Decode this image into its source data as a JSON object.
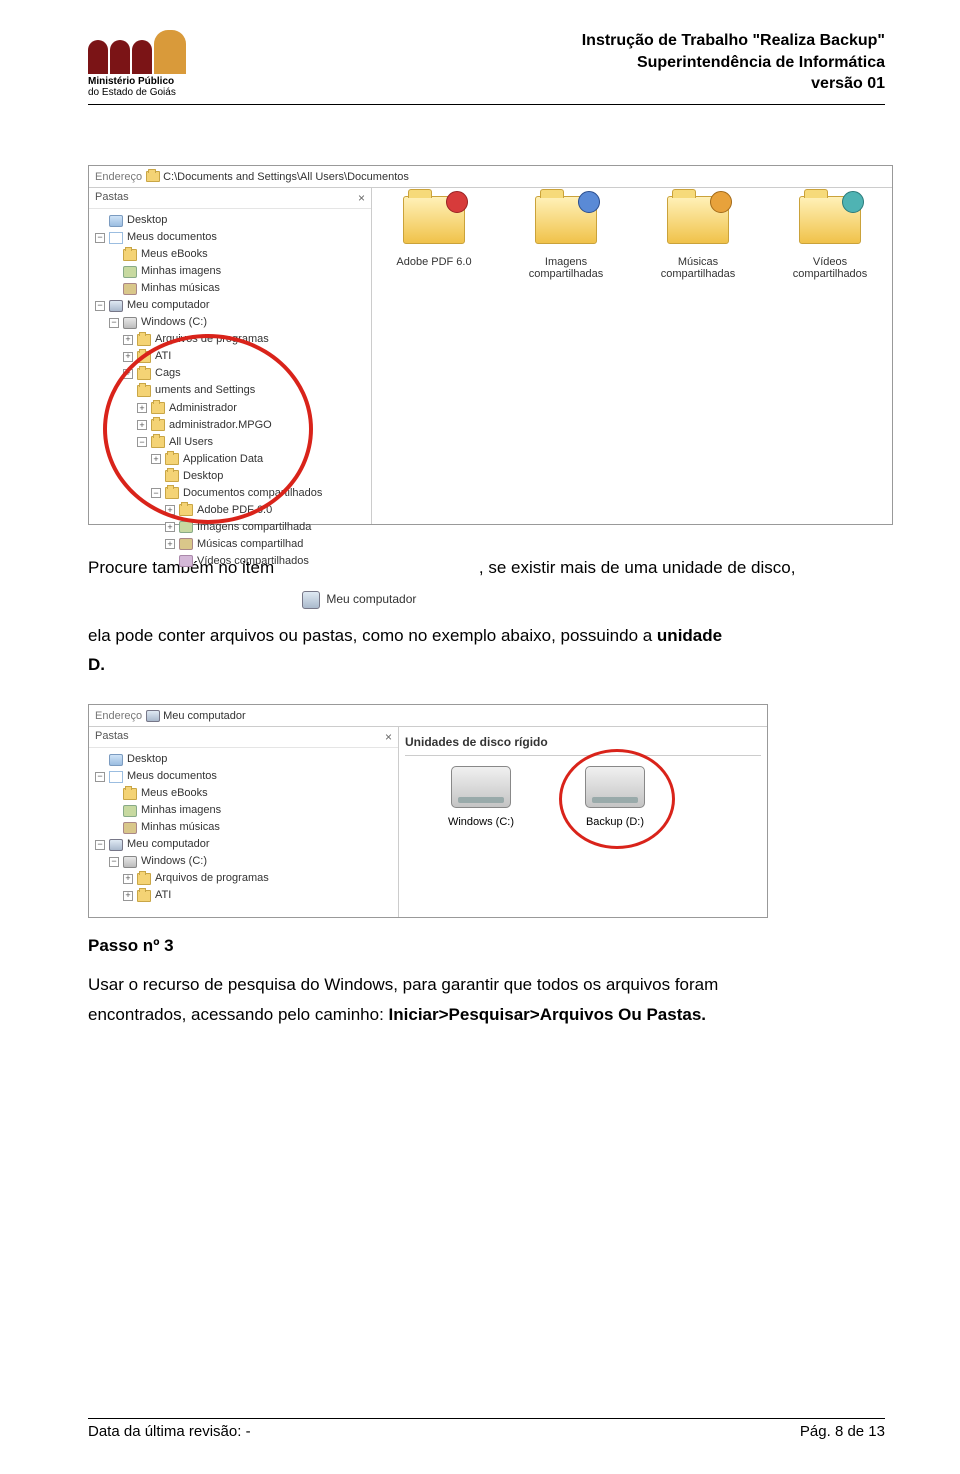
{
  "header": {
    "logo_line1": "Ministério  Público",
    "logo_line2": "do Estado de Goiás",
    "title_line1": "Instrução de Trabalho \"Realiza Backup\"",
    "title_line2": "Superintendência de Informática",
    "title_line3": "versão 01"
  },
  "screenshot1": {
    "address_label": "Endereço",
    "address_path": "C:\\Documents and Settings\\All Users\\Documentos",
    "panes_title": "Pastas",
    "tree": {
      "desktop": "Desktop",
      "meus_documentos": "Meus documentos",
      "meus_ebooks": "Meus eBooks",
      "minhas_imagens": "Minhas imagens",
      "minhas_musicas": "Minhas músicas",
      "meu_computador": "Meu computador",
      "windows_c": "Windows (C:)",
      "arquivos_programas": "Arquivos de programas",
      "ati": "ATI",
      "cags": "Cags",
      "documents_settings": "uments and Settings",
      "administrador": "Administrador",
      "administrador_mpgo": "administrador.MPGO",
      "all_users": "All Users",
      "application_data": "Application Data",
      "desktop2": "Desktop",
      "documentos_compartilhados": "Documentos compartilhados",
      "adobe_pdf": "Adobe PDF 6.0",
      "imagens_comp": "Imagens compartilhada",
      "musicas_comp": "Músicas compartilhad",
      "videos_comp": "Vídeos compartilhados"
    },
    "folders": {
      "f1": "Adobe PDF 6.0",
      "f2": "Imagens compartilhadas",
      "f3": "Músicas compartilhadas",
      "f4": "Vídeos compartilhados"
    }
  },
  "paragraph1": {
    "p1a": "Procure também no item",
    "meu_comp": "Meu computador",
    "p1b": ", se existir mais de uma unidade de disco,",
    "p1c": "ela pode conter arquivos ou pastas, como no exemplo abaixo, possuindo a ",
    "unidade": "unidade",
    "d": "D."
  },
  "screenshot2": {
    "address_label": "Endereço",
    "meu_comp": "Meu computador",
    "panes_title": "Pastas",
    "section_head": "Unidades de disco rígido",
    "tree": {
      "desktop": "Desktop",
      "meus_documentos": "Meus documentos",
      "meus_ebooks": "Meus eBooks",
      "minhas_imagens": "Minhas imagens",
      "minhas_musicas": "Minhas músicas",
      "meu_computador": "Meu computador",
      "windows_c": "Windows (C:)",
      "arquivos_programas": "Arquivos de programas",
      "ati": "ATI"
    },
    "drives": {
      "d1": "Windows (C:)",
      "d2": "Backup (D:)"
    }
  },
  "passo": {
    "title": "Passo nº 3",
    "body1": "Usar o recurso de pesquisa do Windows, para garantir que todos os arquivos foram",
    "body2": "encontrados, acessando pelo caminho: ",
    "bold_path": "Iniciar>Pesquisar>Arquivos Ou Pastas."
  },
  "footer": {
    "left": "Data da última revisão: -",
    "right": "Pág. 8 de 13"
  }
}
